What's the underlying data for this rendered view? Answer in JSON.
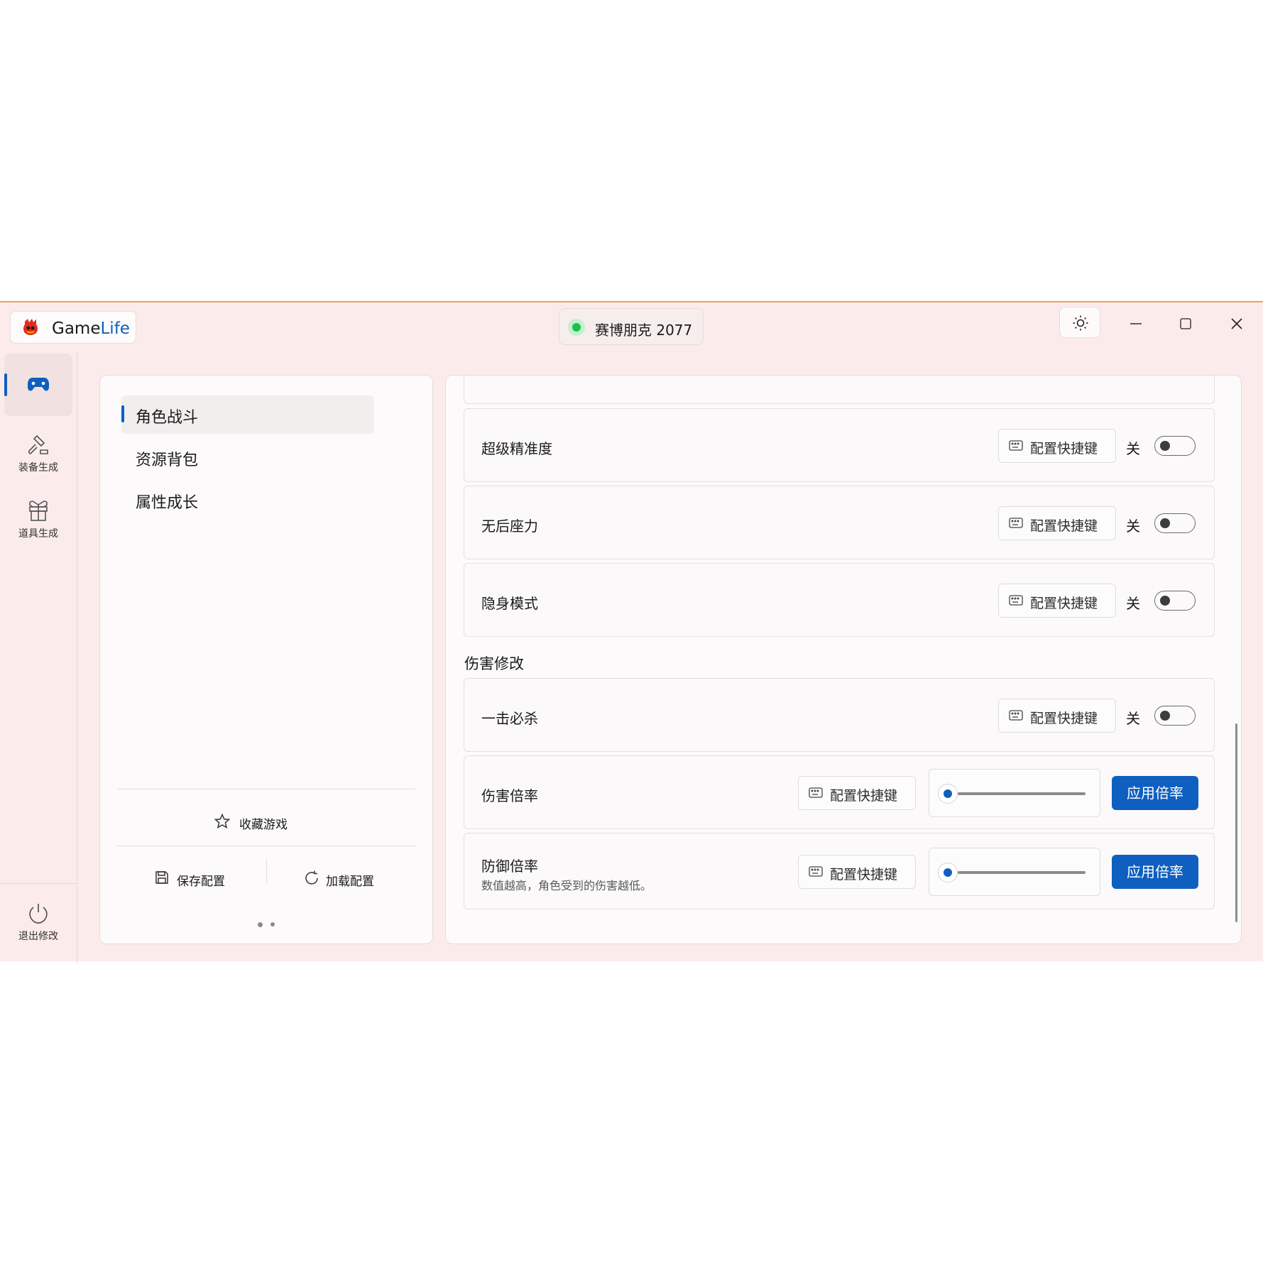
{
  "app": {
    "name_part1": "Game",
    "name_part2": "Life"
  },
  "game": {
    "title": "赛博朋克 2077",
    "status_color": "#1fbf4a"
  },
  "accent_color": "#0f5fc0",
  "rail": {
    "items": [
      {
        "label": "",
        "icon": "gamepad-icon",
        "active": true
      },
      {
        "label": "装备生成",
        "icon": "hammer-icon"
      },
      {
        "label": "道具生成",
        "icon": "gift-icon"
      }
    ],
    "exit_label": "退出修改"
  },
  "categories": {
    "items": [
      {
        "label": "角色战斗",
        "active": true
      },
      {
        "label": "资源背包"
      },
      {
        "label": "属性成长"
      }
    ]
  },
  "left_footer": {
    "favorite_label": "收藏游戏",
    "save_label": "保存配置",
    "load_label": "加载配置"
  },
  "cheats": [
    {
      "title": "超级精准度",
      "hotkey_label": "配置快捷键",
      "state_label": "关"
    },
    {
      "title": "无后座力",
      "hotkey_label": "配置快捷键",
      "state_label": "关"
    },
    {
      "title": "隐身模式",
      "hotkey_label": "配置快捷键",
      "state_label": "关"
    }
  ],
  "damage_section": {
    "title": "伤害修改",
    "toggle_item": {
      "title": "一击必杀",
      "hotkey_label": "配置快捷键",
      "state_label": "关"
    },
    "damage_rate": {
      "title": "伤害倍率",
      "hotkey_label": "配置快捷键",
      "apply_label": "应用倍率",
      "slider_value": 0
    },
    "defense_rate": {
      "title": "防御倍率",
      "subtitle": "数值越高，角色受到的伤害越低。",
      "hotkey_label": "配置快捷键",
      "apply_label": "应用倍率",
      "slider_value": 0
    }
  }
}
